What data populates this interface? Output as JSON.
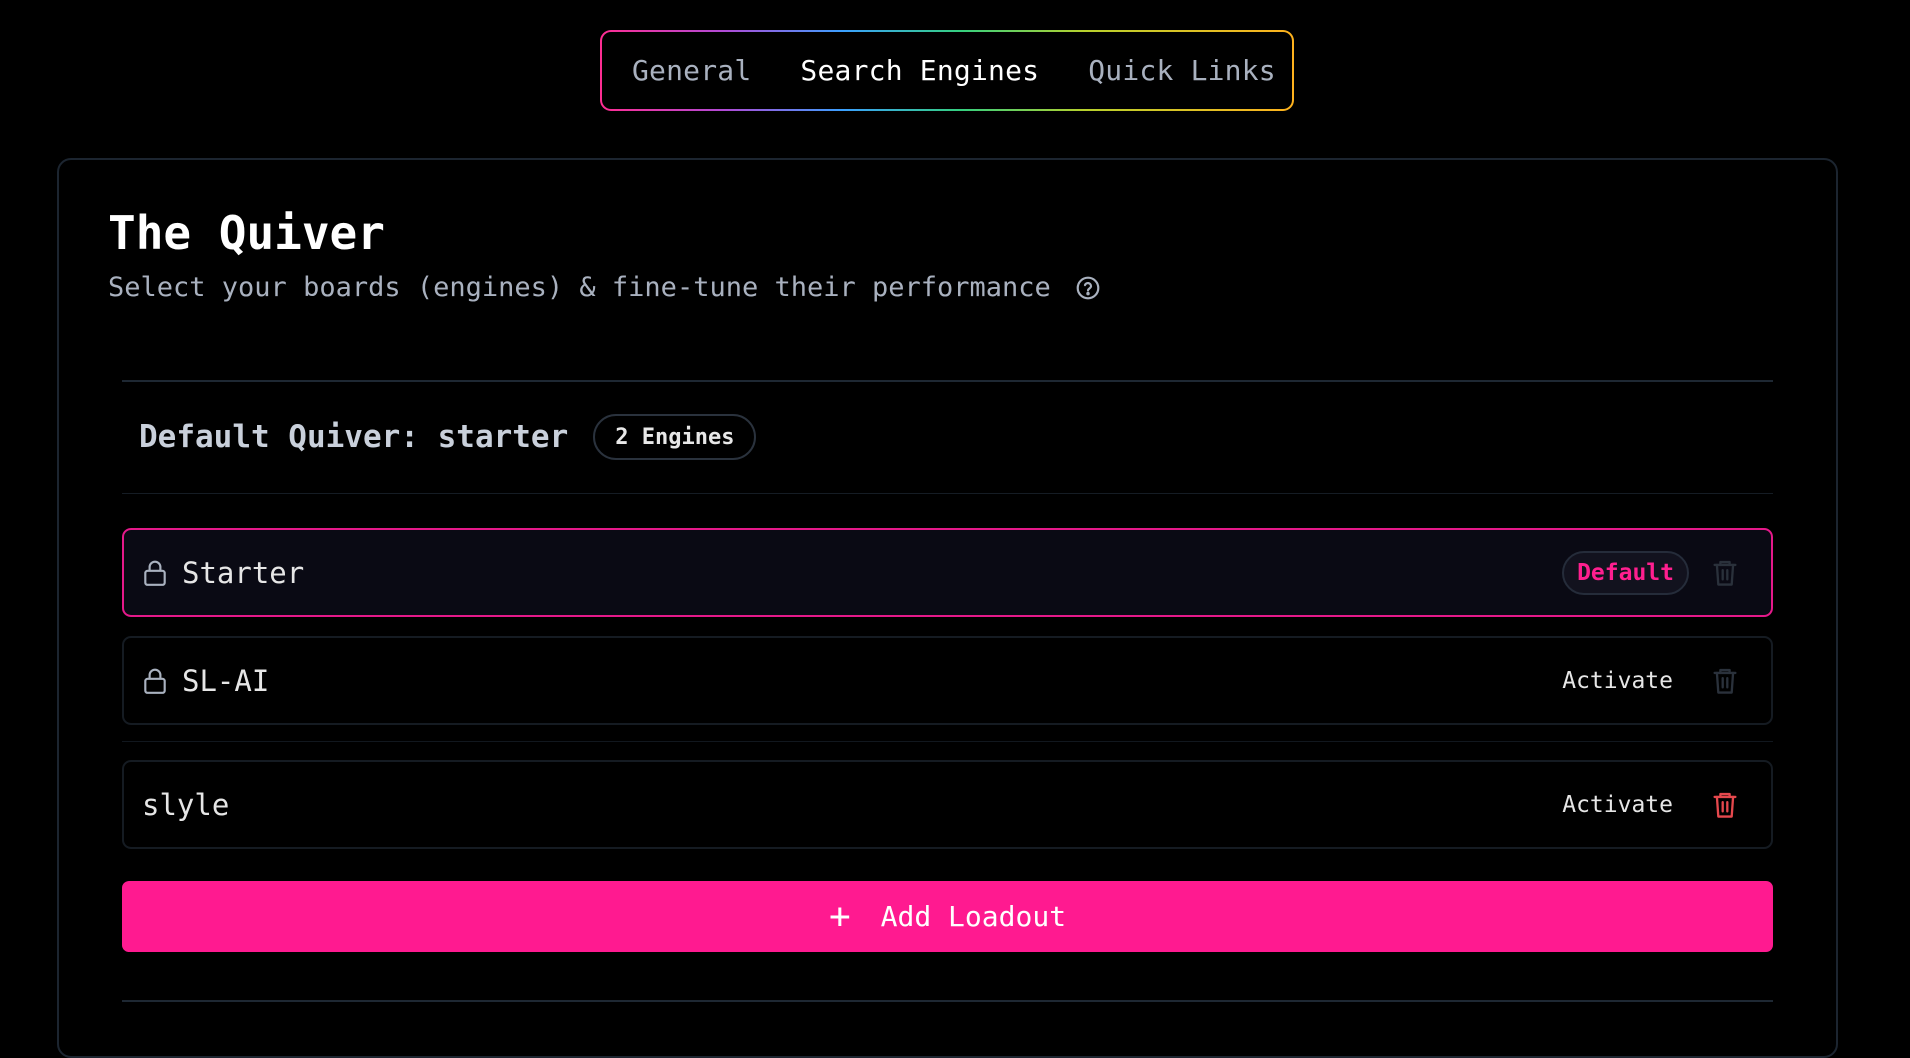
{
  "tabs": [
    {
      "label": "General",
      "active": false
    },
    {
      "label": "Search Engines",
      "active": true
    },
    {
      "label": "Quick Links",
      "active": false
    }
  ],
  "page": {
    "title": "The Quiver",
    "subtitle": "Select your boards (engines) & fine-tune their performance",
    "help_icon": "question-circle-icon"
  },
  "quiver": {
    "title": "Default Quiver: starter",
    "count_badge": "2 Engines"
  },
  "engines": [
    {
      "name": "Starter",
      "locked": true,
      "status": "Default",
      "deletable": false
    },
    {
      "name": "SL-AI",
      "locked": true,
      "action": "Activate",
      "deletable": false
    },
    {
      "name": "slyle",
      "locked": false,
      "action": "Activate",
      "deletable": true
    }
  ],
  "add_button": {
    "label": "Add Loadout",
    "icon": "plus-icon"
  },
  "colors": {
    "accent": "#ff1a90",
    "danger": "#e5484d",
    "muted_text": "#a9b1bf",
    "background": "#000000"
  }
}
